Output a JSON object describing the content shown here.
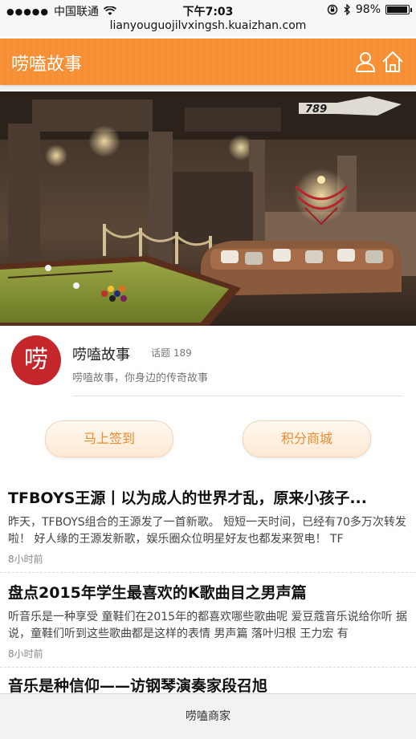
{
  "status_bar": {
    "carrier": "中国联通",
    "time": "下午7:03",
    "battery": "98%",
    "battery_level": 0.98
  },
  "url": "lianyouguojilvxingsh.kuaizhan.com",
  "header": {
    "title": "唠嗑故事",
    "icons": [
      "user-icon",
      "home-icon"
    ]
  },
  "banner": {
    "logo_text": "789"
  },
  "profile": {
    "logo_char": "唠",
    "name": "唠嗑故事",
    "topics": "话题 189",
    "description": "唠嗑故事，你身边的传奇故事"
  },
  "buttons": {
    "signin": "马上签到",
    "shop": "积分商城"
  },
  "articles": [
    {
      "title": "TFBOYS王源丨以为成人的世界才乱，原来小孩子...",
      "summary": "昨天，TFBOYS组合的王源发了一首新歌。 短短一天时间，已经有70多万次转发啦！ 好人缘的王源发新歌，娱乐圈众位明星好友也都发来贺电！ TF",
      "time": "8小时前"
    },
    {
      "title": "盘点2015年学生最喜欢的K歌曲目之男声篇",
      "summary": "听音乐是一种享受 童鞋们在2015年的都喜欢哪些歌曲呢 爱豆蔻音乐说给你听 据说，童鞋们听到这些歌曲都是这样的表情 男声篇 落叶归根 王力宏 有",
      "time": "8小时前"
    },
    {
      "title": "音乐是种信仰——访钢琴演奏家段召旭",
      "summary": "",
      "time": ""
    }
  ],
  "bottom_bar": {
    "label": "唠嗑商家"
  }
}
